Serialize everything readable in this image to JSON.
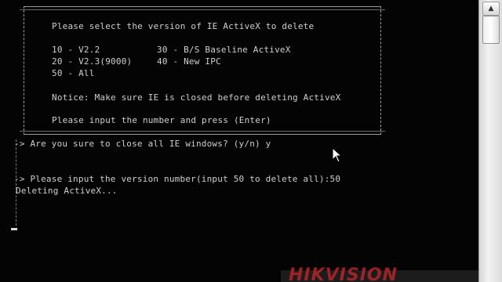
{
  "console": {
    "menu": {
      "title": "Please select the version of IE ActiveX to delete",
      "opt1": "10 - V2.2",
      "opt2": "30 - B/S Baseline ActiveX",
      "opt3": "20 - V2.3(9000)",
      "opt4": "40 - New IPC",
      "opt5": "50 - All",
      "notice": "Notice: Make sure IE is closed before deleting ActiveX",
      "prompt": "Please input the number and press (Enter)"
    },
    "q1": "-> Are you sure to close all IE windows? (y/n) y",
    "q2": "-> Please input the version number(input 50 to delete all):50",
    "status": "Deleting ActiveX..."
  },
  "watermark": "HIKVISION"
}
